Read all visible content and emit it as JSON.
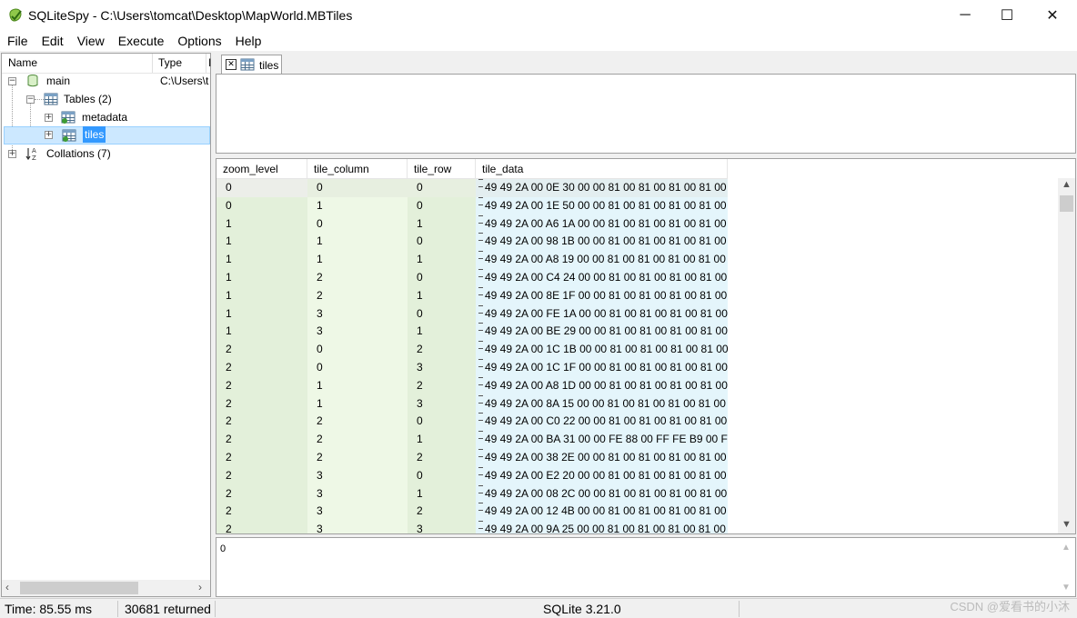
{
  "window": {
    "title": "SQLiteSpy - C:\\Users\\tomcat\\Desktop\\MapWorld.MBTiles",
    "minimize": "─",
    "maximize": "☐",
    "close": "✕"
  },
  "menu": [
    {
      "label": "File"
    },
    {
      "label": "Edit"
    },
    {
      "label": "View"
    },
    {
      "label": "Execute"
    },
    {
      "label": "Options"
    },
    {
      "label": "Help"
    }
  ],
  "tree": {
    "columns": {
      "name": "Name",
      "type": "Type",
      "extra": "I"
    },
    "main_label": "main",
    "main_type": "C:\\Users\\t",
    "tables_label": "Tables (2)",
    "metadata_label": "metadata",
    "tiles_label": "tiles",
    "collations_label": "Collations (7)"
  },
  "tab": {
    "label": "tiles"
  },
  "grid": {
    "columns": [
      "zoom_level",
      "tile_column",
      "tile_row",
      "tile_data"
    ],
    "rows": [
      [
        "0",
        "0",
        "0",
        "49 49 2A 00 0E 30 00 00 81 00 81 00 81 00 81 00"
      ],
      [
        "0",
        "1",
        "0",
        "49 49 2A 00 1E 50 00 00 81 00 81 00 81 00 81 00"
      ],
      [
        "1",
        "0",
        "1",
        "49 49 2A 00 A6 1A 00 00 81 00 81 00 81 00 81 00"
      ],
      [
        "1",
        "1",
        "0",
        "49 49 2A 00 98 1B 00 00 81 00 81 00 81 00 81 00"
      ],
      [
        "1",
        "1",
        "1",
        "49 49 2A 00 A8 19 00 00 81 00 81 00 81 00 81 00"
      ],
      [
        "1",
        "2",
        "0",
        "49 49 2A 00 C4 24 00 00 81 00 81 00 81 00 81 00"
      ],
      [
        "1",
        "2",
        "1",
        "49 49 2A 00 8E 1F 00 00 81 00 81 00 81 00 81 00"
      ],
      [
        "1",
        "3",
        "0",
        "49 49 2A 00 FE 1A 00 00 81 00 81 00 81 00 81 00"
      ],
      [
        "1",
        "3",
        "1",
        "49 49 2A 00 BE 29 00 00 81 00 81 00 81 00 81 00"
      ],
      [
        "2",
        "0",
        "2",
        "49 49 2A 00 1C 1B 00 00 81 00 81 00 81 00 81 00"
      ],
      [
        "2",
        "0",
        "3",
        "49 49 2A 00 1C 1F 00 00 81 00 81 00 81 00 81 00"
      ],
      [
        "2",
        "1",
        "2",
        "49 49 2A 00 A8 1D 00 00 81 00 81 00 81 00 81 00"
      ],
      [
        "2",
        "1",
        "3",
        "49 49 2A 00 8A 15 00 00 81 00 81 00 81 00 81 00"
      ],
      [
        "2",
        "2",
        "0",
        "49 49 2A 00 C0 22 00 00 81 00 81 00 81 00 81 00"
      ],
      [
        "2",
        "2",
        "1",
        "49 49 2A 00 BA 31 00 00 FE 88 00 FF FE B9 00 FF"
      ],
      [
        "2",
        "2",
        "2",
        "49 49 2A 00 38 2E 00 00 81 00 81 00 81 00 81 00"
      ],
      [
        "2",
        "3",
        "0",
        "49 49 2A 00 E2 20 00 00 81 00 81 00 81 00 81 00"
      ],
      [
        "2",
        "3",
        "1",
        "49 49 2A 00 08 2C 00 00 81 00 81 00 81 00 81 00"
      ],
      [
        "2",
        "3",
        "2",
        "49 49 2A 00 12 4B 00 00 81 00 81 00 81 00 81 00"
      ],
      [
        "2",
        "3",
        "3",
        "49 49 2A 00 9A 25 00 00 81 00 81 00 81 00 81 00"
      ]
    ]
  },
  "message_pane": {
    "value": "0"
  },
  "status": {
    "time": "Time: 85.55 ms",
    "returned": "30681 returned",
    "version": "SQLite 3.21.0"
  },
  "watermark": "CSDN @爱看书的小沐"
}
